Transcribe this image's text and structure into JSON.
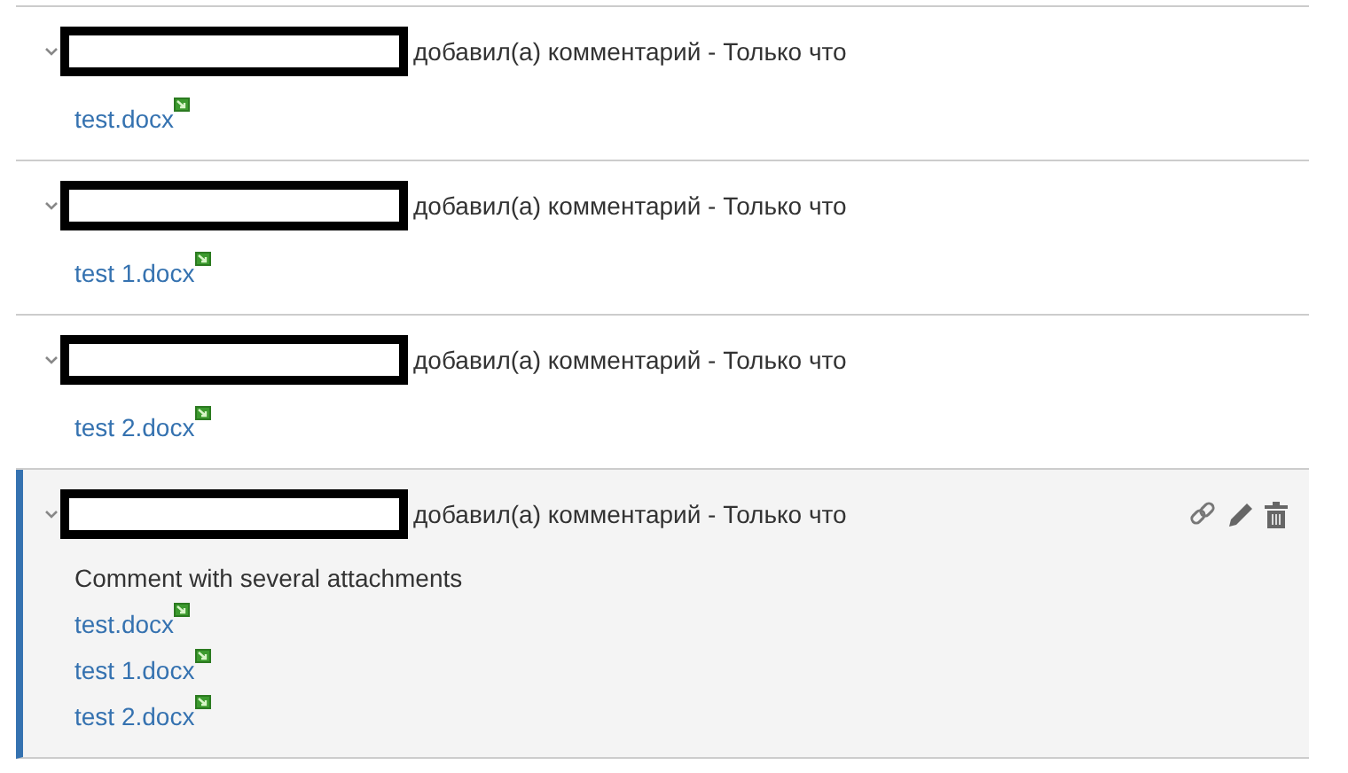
{
  "comments": [
    {
      "expanded": true,
      "selected": false,
      "meta": "добавил(а) комментарий - Только что",
      "attachments": [
        "test.docx"
      ]
    },
    {
      "expanded": true,
      "selected": false,
      "meta": "добавил(а) комментарий - Только что",
      "attachments": [
        "test 1.docx"
      ]
    },
    {
      "expanded": true,
      "selected": false,
      "meta": "добавил(а) комментарий - Только что",
      "attachments": [
        "test 2.docx"
      ]
    },
    {
      "expanded": true,
      "selected": true,
      "meta": "добавил(а) комментарий - Только что",
      "body": "Comment with several attachments",
      "attachments": [
        "test.docx",
        "test 1.docx",
        "test 2.docx"
      ]
    }
  ]
}
